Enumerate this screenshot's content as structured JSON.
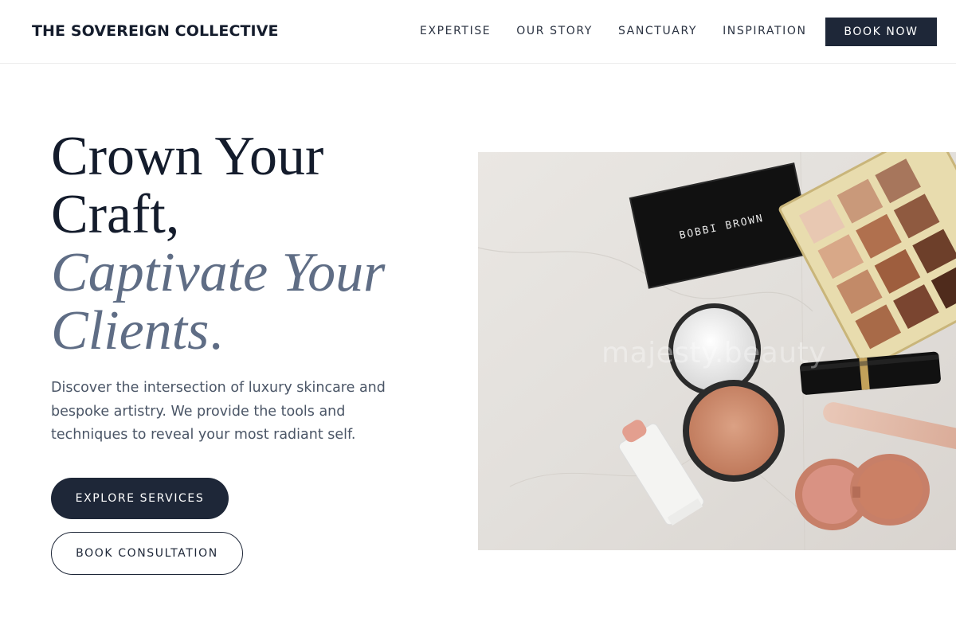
{
  "header": {
    "brand": "THE SOVEREIGN COLLECTIVE",
    "nav": [
      "EXPERTISE",
      "OUR STORY",
      "SANCTUARY",
      "INSPIRATION"
    ],
    "cta": "BOOK NOW"
  },
  "hero": {
    "headline_line1": "Crown Your",
    "headline_line2": "Craft,",
    "headline_italic1": "Captivate Your",
    "headline_italic2": "Clients",
    "headline_period": ".",
    "description": "Discover the intersection of luxury skincare and bespoke artistry. We provide the tools and techniques to reveal your most radiant self.",
    "primary_button": "EXPLORE SERVICES",
    "secondary_button": "BOOK CONSULTATION"
  },
  "image": {
    "watermark": "majesty.beauty",
    "compact_brand": "BOBBI BROWN"
  },
  "colors": {
    "navy": "#1e2738",
    "slate": "#5f6d85",
    "text": "#4a5566"
  }
}
